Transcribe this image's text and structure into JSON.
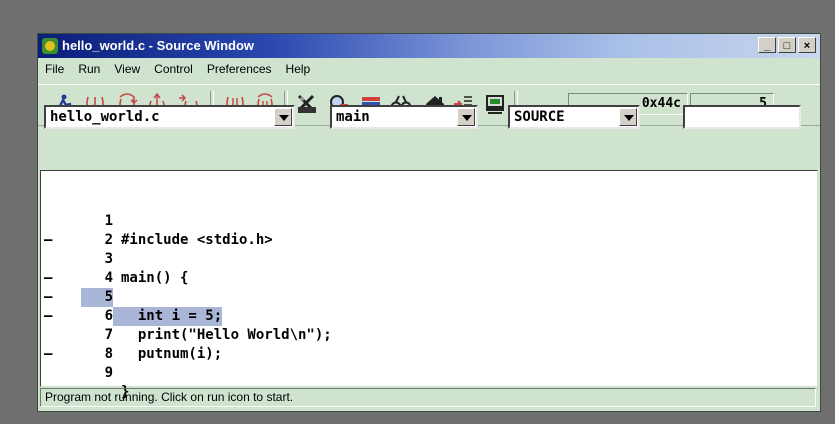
{
  "window": {
    "title": "hello_world.c - Source Window",
    "controls": [
      "_",
      "□",
      "×"
    ]
  },
  "menu": [
    "File",
    "Run",
    "View",
    "Control",
    "Preferences",
    "Help"
  ],
  "toolbar": {
    "icons": [
      "run-icon",
      "step-icon",
      "next-icon",
      "finish-icon",
      "continue-icon",
      "stepi-icon",
      "nexti-icon",
      "registers-icon",
      "memory-icon",
      "stack-icon",
      "watch-icon",
      "locals-icon",
      "breakpoints-icon",
      "console-icon"
    ],
    "pc": "0x44c",
    "line": "5"
  },
  "selectors": {
    "file": "hello_world.c",
    "function": "main",
    "mode": "SOURCE",
    "search": ""
  },
  "source": [
    {
      "num": "1",
      "bp": "",
      "text": "#include <stdio.h>"
    },
    {
      "num": "2",
      "bp": "",
      "text": ""
    },
    {
      "num": "3",
      "bp": "–",
      "text": "main() {"
    },
    {
      "num": "4",
      "bp": "",
      "text": ""
    },
    {
      "num": "5",
      "bp": "–",
      "text": "  int i = 5;",
      "highlight": true
    },
    {
      "num": "6",
      "bp": "–",
      "text": "  print(\"Hello World\\n\");"
    },
    {
      "num": "7",
      "bp": "–",
      "text": "  putnum(i);"
    },
    {
      "num": "8",
      "bp": "",
      "text": ""
    },
    {
      "num": "9",
      "bp": "–",
      "text": "}"
    }
  ],
  "status": "Program not running. Click on run icon to start."
}
